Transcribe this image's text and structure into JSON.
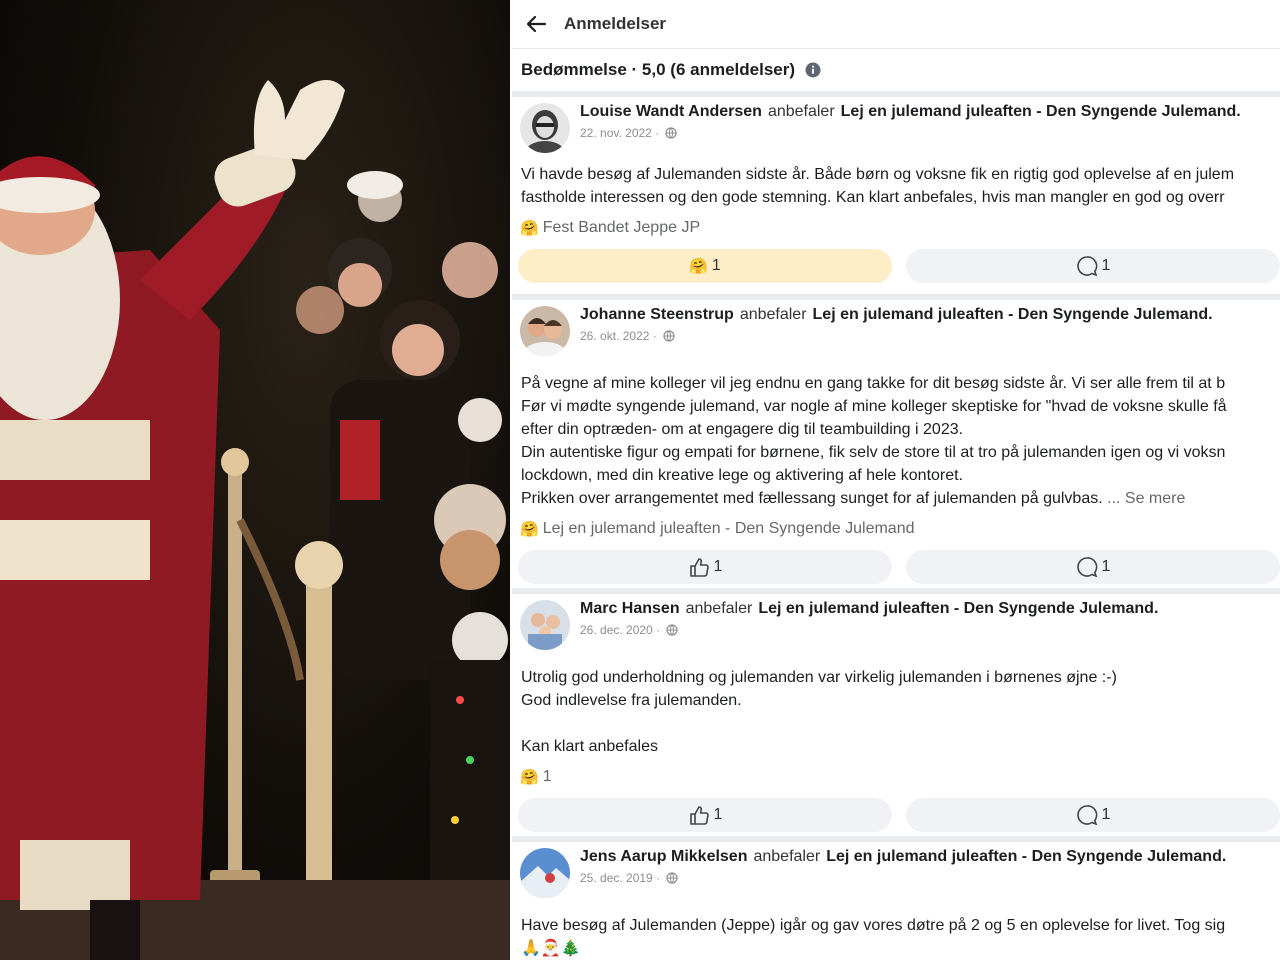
{
  "header": {
    "title": "Anmeldelser"
  },
  "summary": {
    "text": "Bedømmelse · 5,0 (6 anmeldelser)"
  },
  "reviews": [
    {
      "name": "Louise Wandt Andersen",
      "verb": "anbefaler",
      "page": "Lej en julemand juleaften - Den Syngende Julemand.",
      "date": "22. nov. 2022 ·",
      "lines": [
        "Vi havde besøg af Julemanden sidste år. Både børn og voksne fik en rigtig god oplevelse af en julem",
        "fastholde interessen og den gode stemning. Kan klart anbefales, hvis man mangler en god og overr"
      ],
      "reaction_text": "Fest Bandet Jeppe JP",
      "react_count": "1",
      "comment_count": "1"
    },
    {
      "name": "Johanne Steenstrup",
      "verb": "anbefaler",
      "page": "Lej en julemand juleaften - Den Syngende Julemand.",
      "date": "26. okt. 2022 ·",
      "lines": [
        "På vegne af mine kolleger vil jeg endnu en gang takke for dit besøg sidste år. Vi ser alle frem til at b",
        "Før vi mødte syngende julemand, var nogle af mine kolleger skeptiske for \"hvad de voksne skulle få",
        "efter din optræden- om at engagere dig til teambuilding i 2023.",
        "Din autentiske figur og empati for børnene, fik selv de store til at tro på julemanden igen og vi voksn",
        "lockdown, med din kreative lege og aktivering af hele kontoret.",
        "Prikken over arrangementet med fællessang sunget for af julemanden på gulvbas."
      ],
      "see_more": "... Se mere",
      "reaction_text": "Lej en julemand juleaften - Den Syngende Julemand",
      "react_count": "1",
      "comment_count": "1"
    },
    {
      "name": "Marc Hansen",
      "verb": "anbefaler",
      "page": "Lej en julemand juleaften - Den Syngende Julemand.",
      "date": "26. dec. 2020 ·",
      "lines": [
        "Utrolig god underholdning og julemanden var virkelig julemanden i børnenes øjne :-)",
        "God indlevelse fra julemanden.",
        "",
        "Kan klart anbefales"
      ],
      "reaction_text": "1",
      "react_count": "1",
      "comment_count": "1"
    },
    {
      "name": "Jens Aarup Mikkelsen",
      "verb": "anbefaler",
      "page": "Lej en julemand juleaften - Den Syngende Julemand.",
      "date": "25. dec. 2019 ·",
      "lines": [
        "Have besøg af Julemanden (Jeppe) igår og gav vores døtre på 2 og 5 en oplevelse for livet. Tog sig"
      ],
      "emojis": "🙏🎅🎄"
    }
  ],
  "icons": {
    "back": "arrow-left-icon",
    "info": "info-icon",
    "globe": "globe-icon",
    "like": "thumbs-up-icon",
    "comment": "comment-icon",
    "reaction": "hug-emoji-icon"
  },
  "colors": {
    "active_reaction_bg": "#fdeec8",
    "button_bg": "#f0f2f5",
    "separator": "#e9ebee"
  }
}
